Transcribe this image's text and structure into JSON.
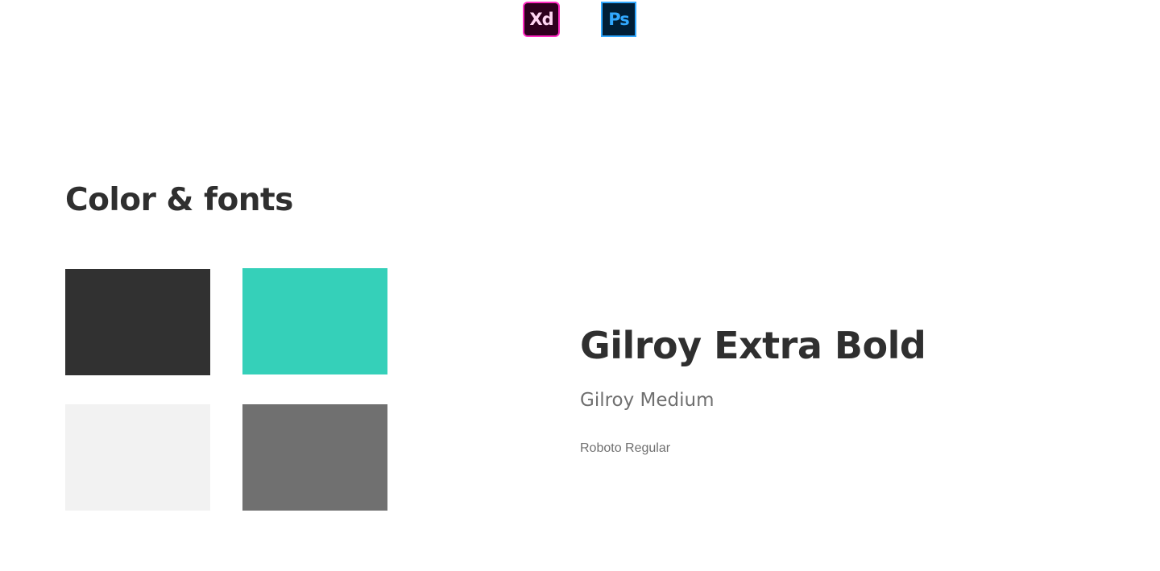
{
  "tools": [
    {
      "name": "adobe-xd-icon",
      "label": "Xd"
    },
    {
      "name": "photoshop-icon",
      "label": "Ps"
    }
  ],
  "section": {
    "title": "Color & fonts"
  },
  "colors": {
    "dark": "#313131",
    "teal": "#35d0b9",
    "light": "#f2f2f2",
    "gray": "#707070"
  },
  "fonts": {
    "extra_bold": "Gilroy Extra Bold",
    "medium": "Gilroy Medium",
    "regular": "Roboto Regular"
  }
}
